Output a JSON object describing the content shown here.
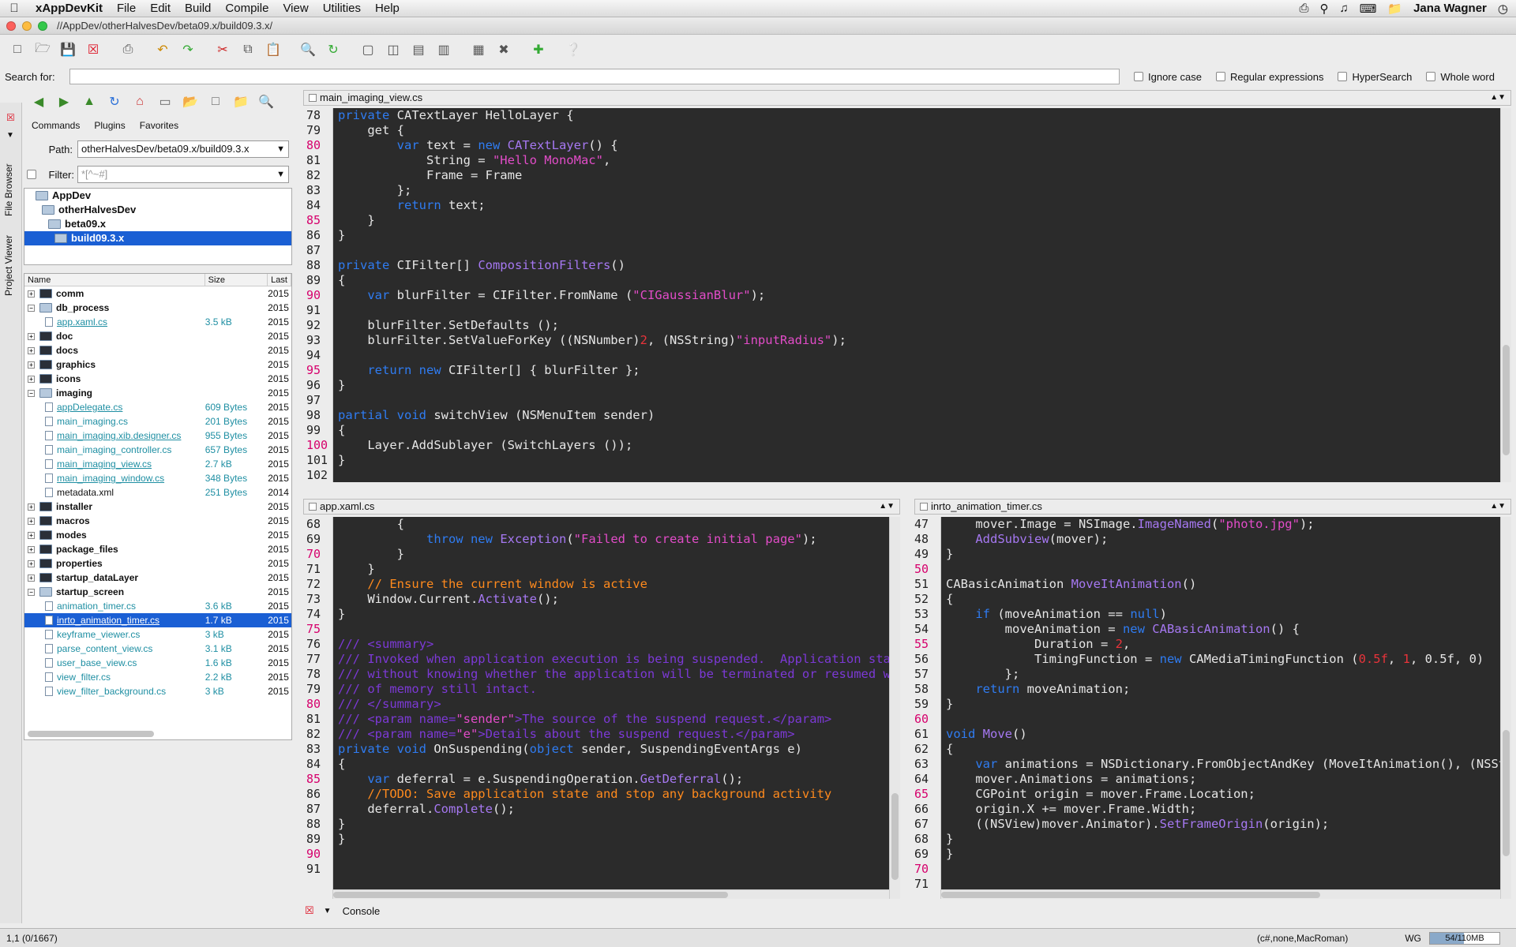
{
  "menubar": {
    "app": "xAppDevKit",
    "items": [
      "File",
      "Edit",
      "Build",
      "Compile",
      "View",
      "Utilities",
      "Help"
    ],
    "user": "Jana Wagner"
  },
  "window": {
    "title": "//AppDev/otherHalvesDev/beta09.x/build09.3.x/"
  },
  "search": {
    "label": "Search for:",
    "value": "",
    "options": [
      "Ignore case",
      "Regular expressions",
      "HyperSearch",
      "Whole word"
    ]
  },
  "sidetabs": {
    "file_browser": "File Browser",
    "project_viewer": "Project Viewer"
  },
  "browser": {
    "subtabs": [
      "Commands",
      "Plugins",
      "Favorites"
    ],
    "path_label": "Path:",
    "path_value": "otherHalvesDev/beta09.x/build09.3.x",
    "filter_label": "Filter:",
    "filter_value": "*[^~#]",
    "dirs": [
      "AppDev",
      "otherHalvesDev",
      "beta09.x",
      "build09.3.x"
    ],
    "columns": [
      "Name",
      "Size",
      "Last"
    ],
    "files": [
      {
        "name": "comm",
        "size": "",
        "date": "2015",
        "dir": true,
        "open": false
      },
      {
        "name": "db_process",
        "size": "",
        "date": "2015",
        "dir": true,
        "open": true
      },
      {
        "name": "app.xaml.cs",
        "size": "3.5 kB",
        "date": "2015",
        "dir": false,
        "link": true
      },
      {
        "name": "doc",
        "size": "",
        "date": "2015",
        "dir": true,
        "open": false
      },
      {
        "name": "docs",
        "size": "",
        "date": "2015",
        "dir": true,
        "open": false
      },
      {
        "name": "graphics",
        "size": "",
        "date": "2015",
        "dir": true,
        "open": false
      },
      {
        "name": "icons",
        "size": "",
        "date": "2015",
        "dir": true,
        "open": false
      },
      {
        "name": "imaging",
        "size": "",
        "date": "2015",
        "dir": true,
        "open": true
      },
      {
        "name": "appDelegate.cs",
        "size": "609 Bytes",
        "date": "2015",
        "dir": false,
        "link": true
      },
      {
        "name": "main_imaging.cs",
        "size": "201 Bytes",
        "date": "2015",
        "dir": false,
        "link": false
      },
      {
        "name": "main_imaging.xib.designer.cs",
        "size": "955 Bytes",
        "date": "2015",
        "dir": false,
        "link": true
      },
      {
        "name": "main_imaging_controller.cs",
        "size": "657 Bytes",
        "date": "2015",
        "dir": false,
        "link": false
      },
      {
        "name": "main_imaging_view.cs",
        "size": "2.7 kB",
        "date": "2015",
        "dir": false,
        "link": true
      },
      {
        "name": "main_imaging_window.cs",
        "size": "348 Bytes",
        "date": "2015",
        "dir": false,
        "link": true
      },
      {
        "name": "metadata.xml",
        "size": "251 Bytes",
        "date": "2014",
        "dir": false,
        "link": false,
        "black": true
      },
      {
        "name": "installer",
        "size": "",
        "date": "2015",
        "dir": true,
        "open": false
      },
      {
        "name": "macros",
        "size": "",
        "date": "2015",
        "dir": true,
        "open": false
      },
      {
        "name": "modes",
        "size": "",
        "date": "2015",
        "dir": true,
        "open": false
      },
      {
        "name": "package_files",
        "size": "",
        "date": "2015",
        "dir": true,
        "open": false
      },
      {
        "name": "properties",
        "size": "",
        "date": "2015",
        "dir": true,
        "open": false
      },
      {
        "name": "startup_dataLayer",
        "size": "",
        "date": "2015",
        "dir": true,
        "open": false
      },
      {
        "name": "startup_screen",
        "size": "",
        "date": "2015",
        "dir": true,
        "open": true
      },
      {
        "name": "animation_timer.cs",
        "size": "3.6 kB",
        "date": "2015",
        "dir": false,
        "link": false
      },
      {
        "name": "inrto_animation_timer.cs",
        "size": "1.7 kB",
        "date": "2015",
        "dir": false,
        "link": true,
        "selected": true
      },
      {
        "name": "keyframe_viewer.cs",
        "size": "3 kB",
        "date": "2015",
        "dir": false,
        "link": false
      },
      {
        "name": "parse_content_view.cs",
        "size": "3.1 kB",
        "date": "2015",
        "dir": false,
        "link": false
      },
      {
        "name": "user_base_view.cs",
        "size": "1.6 kB",
        "date": "2015",
        "dir": false,
        "link": false
      },
      {
        "name": "view_filter.cs",
        "size": "2.2 kB",
        "date": "2015",
        "dir": false,
        "link": false
      },
      {
        "name": "view_filter_background.cs",
        "size": "3 kB",
        "date": "2015",
        "dir": false,
        "link": false
      }
    ]
  },
  "editor_top": {
    "file": "main_imaging_view.cs",
    "start": 78,
    "marked": [
      80,
      85,
      90,
      95,
      100
    ],
    "lines": [
      [
        [
          "k",
          "private "
        ],
        [
          "",
          "CATextLayer HelloLayer {"
        ]
      ],
      [
        [
          "",
          "    get {"
        ]
      ],
      [
        [
          "k",
          "        var "
        ],
        [
          "",
          "text = "
        ],
        [
          "k",
          "new "
        ],
        [
          "ty",
          "CATextLayer"
        ],
        [
          "",
          "() {"
        ]
      ],
      [
        [
          "",
          "            String = "
        ],
        [
          "s",
          "\"Hello MonoMac\""
        ],
        [
          "",
          ","
        ]
      ],
      [
        [
          "",
          "            Frame = Frame"
        ]
      ],
      [
        [
          "",
          "        };"
        ]
      ],
      [
        [
          "k",
          "        return "
        ],
        [
          "",
          "text;"
        ]
      ],
      [
        [
          "",
          "    }"
        ]
      ],
      [
        [
          "",
          "}"
        ]
      ],
      [
        [
          "",
          ""
        ]
      ],
      [
        [
          "k",
          "private "
        ],
        [
          "",
          "CIFilter[] "
        ],
        [
          "ty",
          "CompositionFilters"
        ],
        [
          "",
          "()"
        ]
      ],
      [
        [
          "",
          "{"
        ]
      ],
      [
        [
          "k",
          "    var "
        ],
        [
          "",
          "blurFilter = CIFilter.FromName ("
        ],
        [
          "s",
          "\"CIGaussianBlur\""
        ],
        [
          "",
          ");"
        ]
      ],
      [
        [
          "",
          ""
        ]
      ],
      [
        [
          "",
          "    blurFilter.SetDefaults ();"
        ]
      ],
      [
        [
          "",
          "    blurFilter.SetValueForKey ((NSNumber)"
        ],
        [
          "n",
          "2"
        ],
        [
          "",
          ", (NSString)"
        ],
        [
          "s",
          "\"inputRadius\""
        ],
        [
          "",
          ");"
        ]
      ],
      [
        [
          "",
          ""
        ]
      ],
      [
        [
          "k",
          "    return new "
        ],
        [
          "",
          "CIFilter[] { blurFilter };"
        ]
      ],
      [
        [
          "",
          "}"
        ]
      ],
      [
        [
          "",
          ""
        ]
      ],
      [
        [
          "k",
          "partial void "
        ],
        [
          "",
          "switchView (NSMenuItem sender)"
        ]
      ],
      [
        [
          "",
          "{"
        ]
      ],
      [
        [
          "",
          "    Layer.AddSublayer (SwitchLayers ());"
        ]
      ],
      [
        [
          "",
          "}"
        ]
      ],
      [
        [
          "",
          ""
        ]
      ]
    ]
  },
  "editor_left": {
    "file": "app.xaml.cs",
    "start": 68,
    "marked": [
      70,
      75,
      80,
      85,
      90
    ],
    "lines": [
      [
        [
          "",
          "        {"
        ]
      ],
      [
        [
          "k",
          "            throw new "
        ],
        [
          "ty",
          "Exception"
        ],
        [
          "",
          "("
        ],
        [
          "s",
          "\"Failed to create initial page\""
        ],
        [
          "",
          ");"
        ]
      ],
      [
        [
          "",
          "        }"
        ]
      ],
      [
        [
          "",
          "    }"
        ]
      ],
      [
        [
          "cm",
          "    // Ensure the current window is active"
        ]
      ],
      [
        [
          "",
          "    Window.Current."
        ],
        [
          "ty",
          "Activate"
        ],
        [
          "",
          "();"
        ]
      ],
      [
        [
          "",
          "}"
        ]
      ],
      [
        [
          "",
          ""
        ]
      ],
      [
        [
          "dc",
          "/// <summary>"
        ]
      ],
      [
        [
          "dc",
          "/// Invoked when application execution is being suspended.  Application state is saved"
        ]
      ],
      [
        [
          "dc",
          "/// without knowing whether the application will be terminated or resumed with the contents"
        ]
      ],
      [
        [
          "dc",
          "/// of memory still intact."
        ]
      ],
      [
        [
          "dc",
          "/// </summary>"
        ]
      ],
      [
        [
          "dc",
          "/// <param name="
        ],
        [
          "s",
          "\"sender\""
        ],
        [
          "dc",
          ">The source of the suspend request.</param>"
        ]
      ],
      [
        [
          "dc",
          "/// <param name="
        ],
        [
          "s",
          "\"e\""
        ],
        [
          "dc",
          ">Details about the suspend request.</param>"
        ]
      ],
      [
        [
          "k",
          "private void "
        ],
        [
          "",
          "OnSuspending("
        ],
        [
          "k",
          "object "
        ],
        [
          "",
          "sender, SuspendingEventArgs e)"
        ]
      ],
      [
        [
          "",
          "{"
        ]
      ],
      [
        [
          "k",
          "    var "
        ],
        [
          "",
          "deferral = e.SuspendingOperation."
        ],
        [
          "ty",
          "GetDeferral"
        ],
        [
          "",
          "();"
        ]
      ],
      [
        [
          "cm",
          "    //TODO: Save application state and stop any background activity"
        ]
      ],
      [
        [
          "",
          "    deferral."
        ],
        [
          "ty",
          "Complete"
        ],
        [
          "",
          "();"
        ]
      ],
      [
        [
          "",
          "}"
        ]
      ],
      [
        [
          "",
          "}"
        ]
      ],
      [
        [
          "",
          ""
        ]
      ],
      [
        [
          "",
          ""
        ]
      ]
    ]
  },
  "editor_right": {
    "file": "inrto_animation_timer.cs",
    "start": 47,
    "marked": [
      50,
      55,
      60,
      65,
      70
    ],
    "lines": [
      [
        [
          "",
          "    mover.Image = NSImage."
        ],
        [
          "ty",
          "ImageNamed"
        ],
        [
          "",
          "("
        ],
        [
          "s",
          "\"photo.jpg\""
        ],
        [
          "",
          ");"
        ]
      ],
      [
        [
          "ty",
          "    AddSubview"
        ],
        [
          "",
          "(mover);"
        ]
      ],
      [
        [
          "",
          "}"
        ]
      ],
      [
        [
          "",
          ""
        ]
      ],
      [
        [
          "",
          "CABasicAnimation "
        ],
        [
          "ty",
          "MoveItAnimation"
        ],
        [
          "",
          "()"
        ]
      ],
      [
        [
          "",
          "{"
        ]
      ],
      [
        [
          "k",
          "    if "
        ],
        [
          "",
          "(moveAnimation == "
        ],
        [
          "k",
          "null"
        ],
        [
          "",
          ")"
        ]
      ],
      [
        [
          "",
          "        moveAnimation = "
        ],
        [
          "k",
          "new "
        ],
        [
          "ty",
          "CABasicAnimation"
        ],
        [
          "",
          "() {"
        ]
      ],
      [
        [
          "",
          "            Duration = "
        ],
        [
          "n",
          "2"
        ],
        [
          "",
          ","
        ]
      ],
      [
        [
          "",
          "            TimingFunction = "
        ],
        [
          "k",
          "new "
        ],
        [
          "",
          "CAMediaTimingFunction ("
        ],
        [
          "n",
          "0.5f"
        ],
        [
          "",
          ", "
        ],
        [
          "n",
          "1"
        ],
        [
          "",
          ", 0.5f, 0)"
        ]
      ],
      [
        [
          "",
          "        };"
        ]
      ],
      [
        [
          "k",
          "    return "
        ],
        [
          "",
          "moveAnimation;"
        ]
      ],
      [
        [
          "",
          "}"
        ]
      ],
      [
        [
          "",
          ""
        ]
      ],
      [
        [
          "k",
          "void "
        ],
        [
          "ty",
          "Move"
        ],
        [
          "",
          "()"
        ]
      ],
      [
        [
          "",
          "{"
        ]
      ],
      [
        [
          "k",
          "    var "
        ],
        [
          "",
          "animations = NSDictionary.FromObjectAndKey (MoveItAnimation(), (NSString)"
        ]
      ],
      [
        [
          "",
          "    mover.Animations = animations;"
        ]
      ],
      [
        [
          "",
          "    CGPoint origin = mover.Frame.Location;"
        ]
      ],
      [
        [
          "",
          "    origin.X += mover.Frame.Width;"
        ]
      ],
      [
        [
          "",
          "    ((NSView)mover.Animator)."
        ],
        [
          "ty",
          "SetFrameOrigin"
        ],
        [
          "",
          "(origin);"
        ]
      ],
      [
        [
          "",
          "}"
        ]
      ],
      [
        [
          "",
          "}"
        ]
      ],
      [
        [
          "",
          ""
        ]
      ],
      [
        [
          "",
          ""
        ]
      ]
    ]
  },
  "console": {
    "label": "Console"
  },
  "status": {
    "position": "1,1 (0/1667)",
    "mode": "(c#,none,MacRoman)",
    "wg": "WG",
    "memory": "54/110MB",
    "memory_fraction": 0.49
  }
}
